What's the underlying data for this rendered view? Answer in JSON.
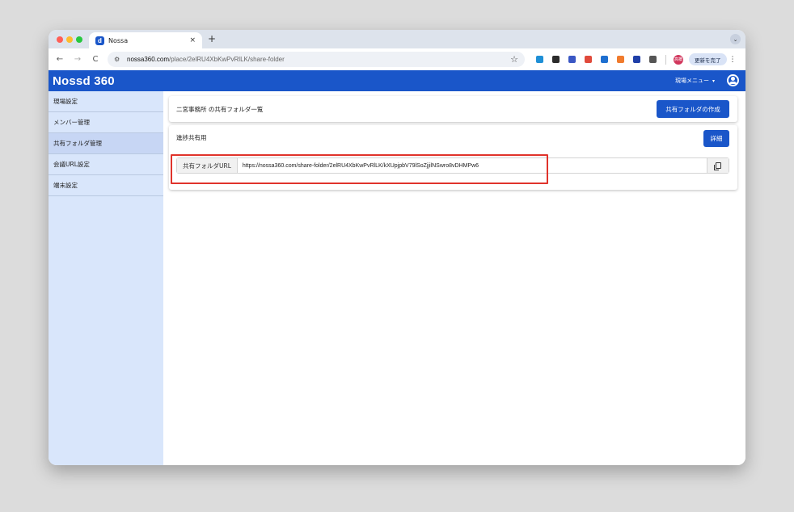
{
  "browser": {
    "tab_title": "Nossa",
    "tab_favicon": "d",
    "close_glyph": "×",
    "new_tab_glyph": "+",
    "tab_menu_glyph": "⌄",
    "back_glyph": "←",
    "forward_glyph": "→",
    "reload_glyph": "C",
    "site_info_glyph": "⚙",
    "url_host": "nossa360.com",
    "url_path": "/place/2elRU4XbKwPvRlLK/share-folder",
    "star_glyph": "☆",
    "profile_label": "高橋",
    "update_button": "更新を完了",
    "kebab_glyph": "⋮",
    "extension_colors": [
      "#1e8fd6",
      "#2b2b2b",
      "#3a57c4",
      "#e04a3b",
      "#1e6fd0",
      "#f07b2d",
      "#1f3fa8",
      "#555555"
    ]
  },
  "header": {
    "logo": "Nossd 360",
    "site_menu": "現場メニュー",
    "caret": "▾",
    "accent": "#1a56c9"
  },
  "sidebar": {
    "items": [
      {
        "label": "現場設定"
      },
      {
        "label": "メンバー管理"
      },
      {
        "label": "共有フォルダ管理"
      },
      {
        "label": "会議URL設定"
      },
      {
        "label": "端末設定"
      }
    ]
  },
  "main": {
    "list_title": "二宮事務所 の共有フォルダ一覧",
    "create_button": "共有フォルダの作成",
    "folder": {
      "name": "進捗共有用",
      "detail_button": "詳細",
      "url_label": "共有フォルダURL",
      "url": "https://nossa360.com/share-folder/2elRU4XbKwPvRlLK/kXUpjpbV79lSoZjjilNSwro8vDHMPw6"
    }
  }
}
